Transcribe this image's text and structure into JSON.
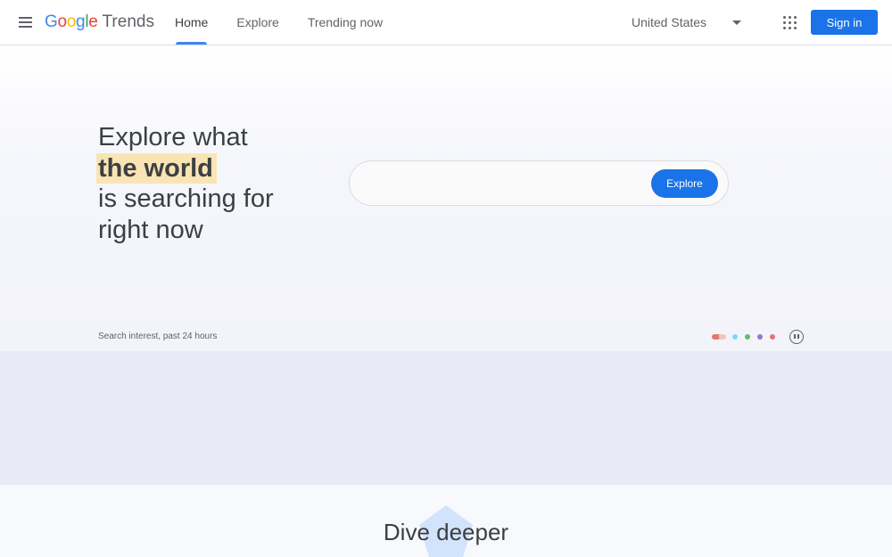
{
  "header": {
    "logo_google": "Google",
    "logo_trends": "Trends",
    "tabs": [
      {
        "label": "Home",
        "active": true
      },
      {
        "label": "Explore",
        "active": false
      },
      {
        "label": "Trending now",
        "active": false
      }
    ],
    "country": "United States",
    "signin_label": "Sign in"
  },
  "hero": {
    "line1": "Explore what",
    "line2": "the world",
    "line3": "is searching for",
    "line4": "right now",
    "search_value": "",
    "explore_label": "Explore",
    "interest_label": "Search interest, past 24 hours",
    "carousel_colors": [
      "#e57373",
      "#81d4fa",
      "#66bb6a",
      "#9575cd",
      "#e57373"
    ]
  },
  "dive": {
    "title": "Dive deeper"
  },
  "colors": {
    "accent": "#1a73e8",
    "tab_indicator": "#4285f4",
    "highlight": "#f9e5b4"
  }
}
